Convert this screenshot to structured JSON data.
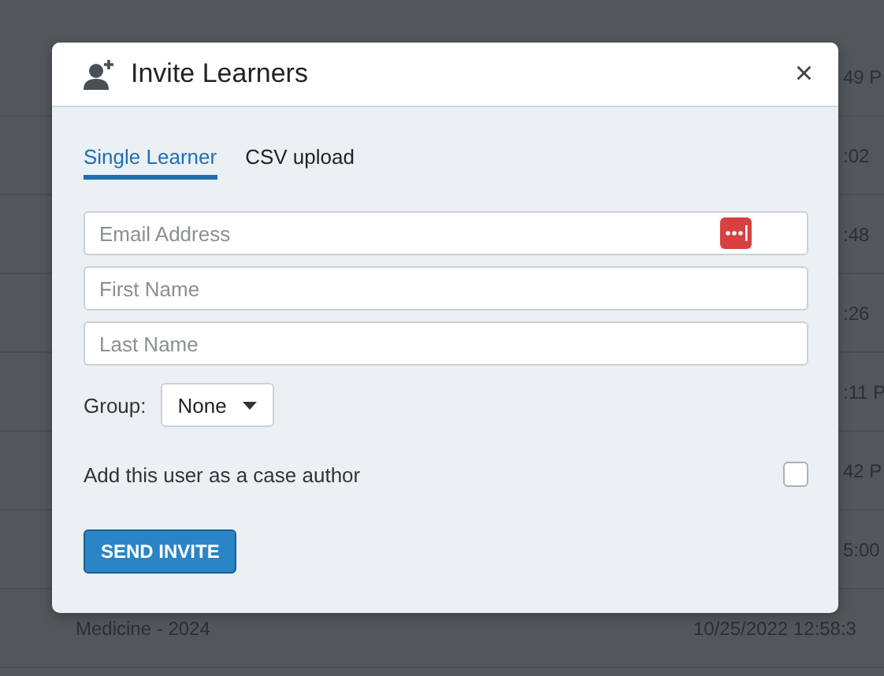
{
  "background_table": {
    "rows": [
      {
        "date": "49 P"
      },
      {
        "date": ":02"
      },
      {
        "date": ":48"
      },
      {
        "date": ":26"
      },
      {
        "date": ":11 P"
      },
      {
        "date": "42 P"
      },
      {
        "date": "5:00"
      },
      {
        "name": "Medicine - 2024",
        "date": "10/25/2022 12:58:3"
      }
    ]
  },
  "dialog": {
    "title": "Invite Learners",
    "close": "×",
    "tabs": [
      {
        "label": "Single Learner",
        "selected": true
      },
      {
        "label": "CSV upload",
        "selected": false
      }
    ],
    "fields": [
      {
        "placeholder": "Email Address",
        "password_manager": true
      },
      {
        "placeholder": "First Name",
        "password_manager": false
      },
      {
        "placeholder": "Last Name",
        "password_manager": false
      }
    ],
    "group": {
      "label": "Group:",
      "value": "None"
    },
    "case_author": {
      "label": "Add this user as a case author",
      "checked": false
    },
    "submit": "SEND INVITE"
  }
}
